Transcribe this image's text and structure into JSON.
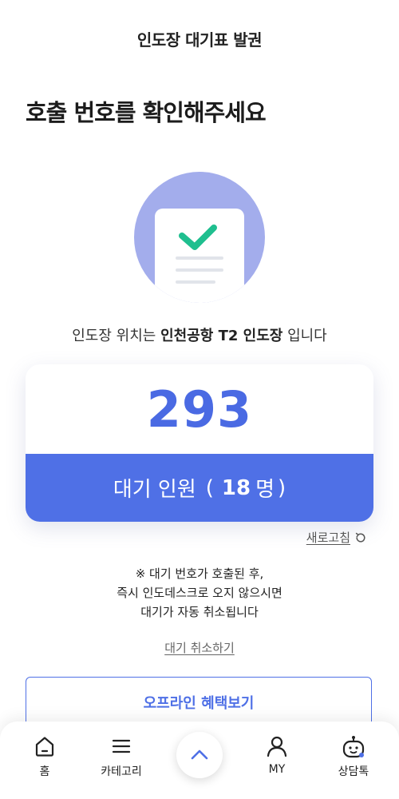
{
  "header": {
    "title": "인도장 대기표 발권"
  },
  "headline": "호출 번호를 확인해주세요",
  "location": {
    "prefix": "인도장 위치는",
    "name": "인천공항 T2 인도장",
    "suffix": "입니다"
  },
  "queue": {
    "number": "293",
    "waiting_label": "대기 인원",
    "open_paren": "(",
    "count": "18",
    "unit": "명",
    "close_paren": ")"
  },
  "refresh": {
    "label": "새로고침",
    "icon": "refresh-icon"
  },
  "notice": {
    "line1": "※ 대기 번호가 호출된 후,",
    "line2": "즉시 인도데스크로 오지 않으시면",
    "line3": "대기가 자동 취소됩니다"
  },
  "cancel_label": "대기 취소하기",
  "offline_button_label": "오프라인 혜택보기",
  "bottom_nav": {
    "items": [
      {
        "label": "홈",
        "icon": "home-icon"
      },
      {
        "label": "카테고리",
        "icon": "menu-icon"
      },
      {
        "label": "MY",
        "icon": "user-icon"
      },
      {
        "label": "상담톡",
        "icon": "chatbot-icon"
      }
    ],
    "scroll_top_icon": "chevron-up-icon"
  },
  "colors": {
    "accent": "#4f70e6",
    "number": "#4a6ae3",
    "illustration_bg": "#a3adec",
    "check": "#1fbf8f"
  }
}
